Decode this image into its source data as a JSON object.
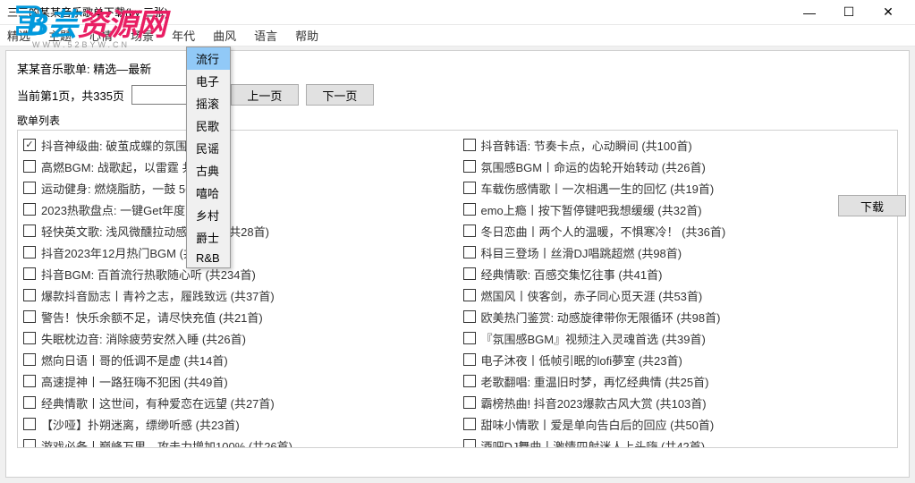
{
  "window": {
    "title": "三三的某某音乐歌单下载(by 三张)"
  },
  "menu": [
    "精选",
    "主题",
    "心情",
    "场景",
    "年代",
    "曲风",
    "语言",
    "帮助"
  ],
  "dropdown": [
    "流行",
    "电子",
    "摇滚",
    "民歌",
    "民谣",
    "古典",
    "嘻哈",
    "乡村",
    "爵士",
    "R&B"
  ],
  "header": "某某音乐歌单: 精选—最新",
  "pager": {
    "info": "当前第1页，共335页",
    "unit": "页",
    "prev": "上一页",
    "next": "下一页"
  },
  "listLabel": "歌单列表",
  "download": "下载",
  "left": [
    {
      "c": true,
      "t": "抖音神级曲: 破茧成蝶的氛围              首)"
    },
    {
      "c": false,
      "t": "高燃BGM: 战歌起，以雷霆          共21首)"
    },
    {
      "c": false,
      "t": "运动健身: 燃烧脂肪，一鼓          56首)"
    },
    {
      "c": false,
      "t": "2023热歌盘点: 一键Get年度          56首)"
    },
    {
      "c": false,
      "t": "轻快英文歌: 浅风微醺拉动感觉氛围  (共28首)"
    },
    {
      "c": false,
      "t": "抖音2023年12月热门BGM  (共33首)"
    },
    {
      "c": false,
      "t": "抖音BGM: 百首流行热歌随心听  (共234首)"
    },
    {
      "c": false,
      "t": "爆款抖音励志丨青衿之志，履践致远  (共37首)"
    },
    {
      "c": false,
      "t": "警告！快乐余额不足，请尽快充值  (共21首)"
    },
    {
      "c": false,
      "t": "失眠枕边音: 消除疲劳安然入睡  (共26首)"
    },
    {
      "c": false,
      "t": "燃向日语丨哥的低调不是虚  (共14首)"
    },
    {
      "c": false,
      "t": "高速提神丨一路狂嗨不犯困  (共49首)"
    },
    {
      "c": false,
      "t": "经典情歌丨这世间，有种爱恋在远望  (共27首)"
    },
    {
      "c": false,
      "t": "【沙哑】扑朔迷离，缥缈听感  (共23首)"
    },
    {
      "c": false,
      "t": "游戏必备丨巅峰万里，攻击力增加100%  (共26首)"
    }
  ],
  "right": [
    {
      "c": false,
      "t": "抖音韩语: 节奏卡点，心动瞬间  (共100首)"
    },
    {
      "c": false,
      "t": "氛围感BGM丨命运的齿轮开始转动  (共26首)"
    },
    {
      "c": false,
      "t": "车载伤感情歌丨一次相遇一生的回忆  (共19首)"
    },
    {
      "c": false,
      "t": "emo上瘾丨按下暂停键吧我想缓缓  (共32首)"
    },
    {
      "c": false,
      "t": "冬日恋曲丨两个人的温暖，不惧寒冷！  (共36首)"
    },
    {
      "c": false,
      "t": "科目三登场丨丝滑DJ唱跳超燃  (共98首)"
    },
    {
      "c": false,
      "t": "经典情歌: 百感交集忆往事  (共41首)"
    },
    {
      "c": false,
      "t": "燃国风丨侠客剑，赤子同心觅天涯  (共53首)"
    },
    {
      "c": false,
      "t": "欧美热门鉴赏: 动感旋律带你无限循环  (共98首)"
    },
    {
      "c": false,
      "t": "『氛围感BGM』视频注入灵魂首选  (共39首)"
    },
    {
      "c": false,
      "t": "电子沐夜丨低帧引眠的lofi夢室  (共23首)"
    },
    {
      "c": false,
      "t": "老歌翻唱: 重温旧时梦，再忆经典情  (共25首)"
    },
    {
      "c": false,
      "t": "霸榜热曲! 抖音2023爆款古风大赏  (共103首)"
    },
    {
      "c": false,
      "t": "甜味小情歌丨爱是单向告白后的回应  (共50首)"
    },
    {
      "c": false,
      "t": "酒吧DJ舞曲丨激情四射迷人上头嗨  (共42首)"
    }
  ],
  "watermark": {
    "t1": "B芸",
    "t2": "资源网",
    "sub": "WWW.52BYW.CN"
  }
}
